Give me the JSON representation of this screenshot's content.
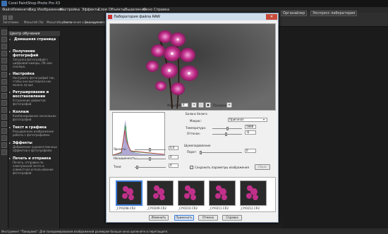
{
  "app": {
    "title": "Corel PaintShop Photo Pro X3"
  },
  "menu": [
    "Файл",
    "Изменить",
    "Вид",
    "Изображение",
    "Настройка",
    "Эффекты",
    "Слои",
    "Объекты",
    "Выделения",
    "Окно",
    "Справка"
  ],
  "workspace": {
    "organizer": "Органайзер",
    "express": "Экспресс-лаборатория"
  },
  "toolbar": {
    "labels": [
      "Заготовки:",
      "Масштаб (%):",
      "Масштабировать",
      "Увеличение и уменьшение",
      "Вид крупного"
    ]
  },
  "learning_center": {
    "header": "Центр обучения",
    "home": "Домашняя страница",
    "items": [
      {
        "title": "Получение фотографий",
        "desc": "Загрузка фотографий с цифровой камеры, ПК или сканера."
      },
      {
        "title": "Настройка",
        "desc": "Настройте фотографий так, чтобы они выглядели как можно лучше"
      },
      {
        "title": "Ретуширование и восстановление",
        "desc": "Устранение дефектов фотографий."
      },
      {
        "title": "Коллаж",
        "desc": "Комбинирование нескольких фотографий."
      },
      {
        "title": "Текст и графика",
        "desc": "Расширенное изображение работы с фотографиями."
      },
      {
        "title": "Эффекты",
        "desc": "Добавление художественных эффектов к фотографиям."
      },
      {
        "title": "Печать и отправка",
        "desc": "Печать, отправка по электронной почте и совместное использование фотографий."
      }
    ]
  },
  "dialog": {
    "title": "Лаборатория файла RAW",
    "zoom_label": "Масштаб",
    "zoom_value": "8",
    "pan_label": "Панорама",
    "white_balance": {
      "header": "Баланс белого",
      "preset_label": "Макрос:",
      "preset_value": "Оригинал",
      "temperature_label": "Температура:",
      "temperature_value": "5888",
      "tint_label": "Оттенок:",
      "tint_value": "-6"
    },
    "noise": {
      "header": "Шумоподавление",
      "threshold_label": "Порог:",
      "threshold_value": "0"
    },
    "adjust": {
      "brightness_label": "Яркость:",
      "brightness_value": "0,0",
      "saturation_label": "Насыщенность:",
      "saturation_value": "0",
      "shadows_label": "Тени:",
      "shadows_value": "0"
    },
    "save_params_label": "Сохранить параметры изображения",
    "reset_label": "Сброс",
    "thumbnails": [
      "_CIY0208.CR2",
      "_CIY0209.CR2",
      "_CIY0210.CR2",
      "_CIY0211.CR2",
      "_CIY0212.CR2"
    ],
    "buttons": {
      "apply_edit": "Изменить",
      "apply": "Применить",
      "cancel": "Отмена",
      "help": "Справка"
    }
  },
  "status": "Инструмент \"Панорама\": Для панорамирования изображений размером больше окна щелкните и перетащите.",
  "colors": {
    "accent": "#3a7bd5",
    "orchid": "#c0308a",
    "dark": "#1e1e1e"
  }
}
